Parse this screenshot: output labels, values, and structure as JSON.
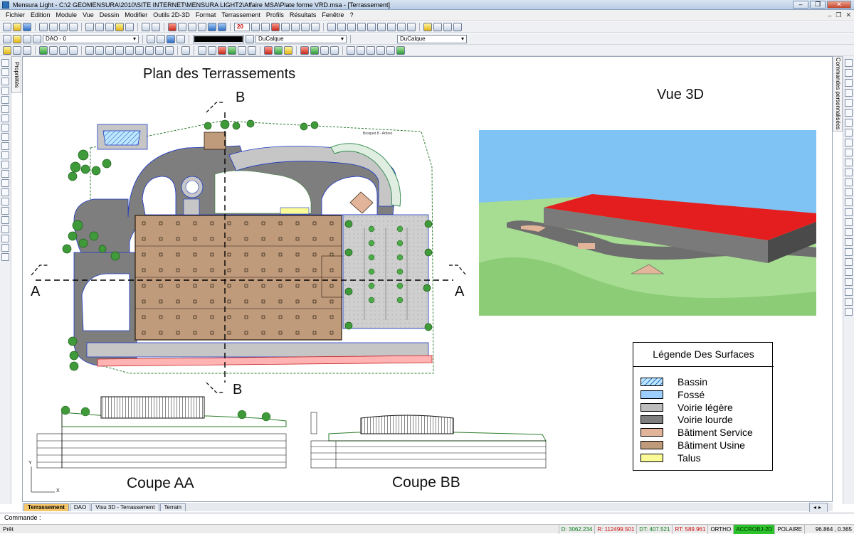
{
  "window": {
    "title": "Mensura Light - C:\\2 GEOMENSURA\\2010\\SITE INTERNET\\MENSURA LIGHT2\\Affaire MSA\\Plate forme VRD.msa - [Terrassement]",
    "minimize": "–",
    "maximize": "❐",
    "close": "✕"
  },
  "menu": {
    "items": [
      "Fichier",
      "Edition",
      "Module",
      "Vue",
      "Dessin",
      "Modifier",
      "Outils 2D-3D",
      "Format",
      "Terrassement",
      "Profils",
      "Résultats",
      "Fenêtre",
      "?"
    ],
    "mdi": [
      "–",
      "❐",
      "✕"
    ]
  },
  "toolbar": {
    "layer": "DAO - 0",
    "linetype": "DuCalque",
    "lineweight": "DuCalque",
    "zoom_value": "20"
  },
  "side_tabs": {
    "properties": "Propriétés",
    "custom_commands": "Commandes personnalisées"
  },
  "drawing": {
    "plan_title": "Plan des Terrassements",
    "view3d_title": "Vue 3D",
    "section_a_left": "A",
    "section_a_right": "A",
    "section_b_top": "B",
    "section_b_bottom": "B",
    "coupe_aa": "Coupe  AA",
    "coupe_bb": "Coupe  BB",
    "bosquet_label": "Bosquet 8 - Arbres",
    "axis_y": "Y",
    "axis_x": "X"
  },
  "legend": {
    "title": "Légende Des Surfaces",
    "items": [
      {
        "label": "Bassin",
        "color": "#bfe6ff",
        "hatch": true
      },
      {
        "label": "Fossé",
        "color": "#9ccfff"
      },
      {
        "label": "Voirie légère",
        "color": "#bdbdbd"
      },
      {
        "label": "Voirie lourde",
        "color": "#7e7e7e"
      },
      {
        "label": "Bâtiment Service",
        "color": "#e2b59a"
      },
      {
        "label": "Bâtiment Usine",
        "color": "#bf9b7c"
      },
      {
        "label": "Talus",
        "color": "#fafa96"
      }
    ]
  },
  "layout_tabs": [
    "Terrassement",
    "DAO",
    "Visu 3D - Terrassement",
    "Terrain"
  ],
  "layout_active": "Terrassement",
  "command": {
    "label": "Commande :"
  },
  "status": {
    "ready": "Prêt",
    "d": "D: 3062.234",
    "r": "R: 112499.501",
    "dt": "DT: 407.521",
    "rt": "RT: 589.961",
    "ortho": "ORTHO",
    "accrobj": "ACCROBJ-2D",
    "polaire": "POLAIRE",
    "coords": "96.864 , 0.365"
  },
  "colors": {
    "road_heavy": "#7e7e7e",
    "road_light": "#c6c6c6",
    "building": "#bf9b7c",
    "grass": "#9fd08c",
    "sky": "#7ec3f3",
    "roof": "#e41e1e",
    "active_tab": "#f6c66a"
  }
}
